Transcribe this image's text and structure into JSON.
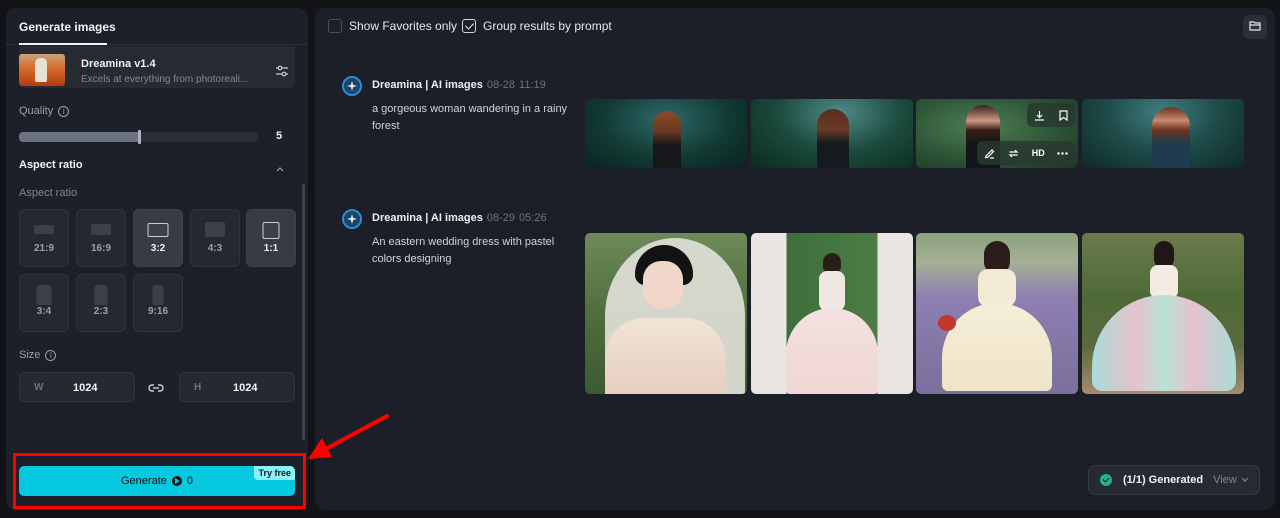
{
  "left_panel": {
    "title": "Generate images",
    "model": {
      "name": "Dreamina v1.4",
      "description": "Excels at everything from photoreali..."
    },
    "quality": {
      "label": "Quality",
      "value": 5,
      "value_label": "5",
      "fill_fraction": 0.5
    },
    "aspect_ratio_section": {
      "title": "Aspect ratio",
      "label": "Aspect ratio"
    },
    "ratios": [
      {
        "label": "21:9",
        "selected": false
      },
      {
        "label": "16:9",
        "selected": false
      },
      {
        "label": "3:2",
        "selected": true
      },
      {
        "label": "4:3",
        "selected": false
      },
      {
        "label": "1:1",
        "selected": true
      },
      {
        "label": "3:4",
        "selected": false
      },
      {
        "label": "2:3",
        "selected": false
      },
      {
        "label": "9:16",
        "selected": false
      }
    ],
    "size": {
      "label": "Size",
      "width_prefix": "W",
      "width": "1024",
      "height_prefix": "H",
      "height": "1024"
    },
    "generate": {
      "label": "Generate",
      "credits": "0",
      "badge": "Try free"
    }
  },
  "right_panel": {
    "show_favorites": {
      "label": "Show Favorites only",
      "checked": false
    },
    "group_by_prompt": {
      "label": "Group results by prompt",
      "checked": true
    },
    "groups": [
      {
        "author": "Dreamina | AI images",
        "date": "08-28",
        "time": "11:19",
        "prompt": "a gorgeous woman wandering in a rainy forest",
        "images": [
          "woman in rainy forest 1",
          "woman in rainy forest 2",
          "woman in rainy forest 3",
          "woman in rainy forest 4"
        ]
      },
      {
        "author": "Dreamina | AI images",
        "date": "08-29",
        "time": "05:26",
        "prompt": "An eastern wedding dress with pastel colors designing",
        "images": [
          "bride with veil portrait",
          "bride between columns",
          "bride in lavender field",
          "bride in pastel gown garden"
        ]
      }
    ],
    "hover_actions": {
      "hd_label": "HD"
    },
    "status": {
      "text": "(1/1) Generated",
      "view_label": "View"
    }
  },
  "colors": {
    "accent": "#06c8df",
    "status_success": "#1fb48c",
    "annotation": "#ff0000"
  }
}
